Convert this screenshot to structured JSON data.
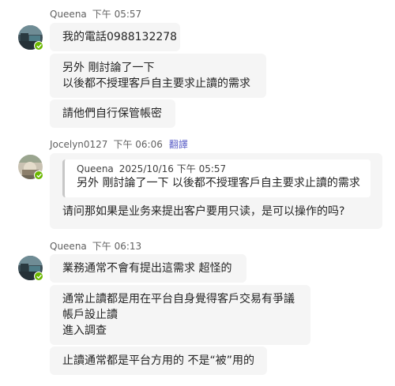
{
  "messages": [
    {
      "author": "Queena",
      "time": "下午 05:57",
      "bubbles": [
        {
          "lines": [
            "我的電話0988132278"
          ]
        },
        {
          "lines": [
            "另外 剛討論了一下",
            "以後都不授理客戶自主要求止讀的需求"
          ]
        },
        {
          "lines": [
            "請他們自行保管帳密"
          ]
        }
      ]
    },
    {
      "author": "Jocelyn0127",
      "time": "下午 06:06",
      "translate_label": "翻譯",
      "quote": {
        "author": "Queena",
        "datetime": "2025/10/16 下午 05:57",
        "text": "另外 剛討論了一下 以後都不授理客戶自主要求止讀的需求"
      },
      "reply": "请问那如果是业务来提出客户要用只读，是可以操作的吗?"
    },
    {
      "author": "Queena",
      "time": "下午 06:13",
      "bubbles": [
        {
          "lines": [
            "業務通常不會有提出這需求 超怪的"
          ]
        },
        {
          "lines": [
            "通常止讀都是用在平台自身覺得客戶交易有爭議",
            "帳戶設止讀",
            "進入調查"
          ]
        },
        {
          "lines": [
            "止讀通常都是平台方用的 不是“被”用的"
          ]
        }
      ]
    }
  ],
  "colors": {
    "bubble_bg": "#f5f5f5",
    "presence_available": "#6bb700",
    "translate_link": "#5b5fc7",
    "meta_text": "#616161"
  }
}
